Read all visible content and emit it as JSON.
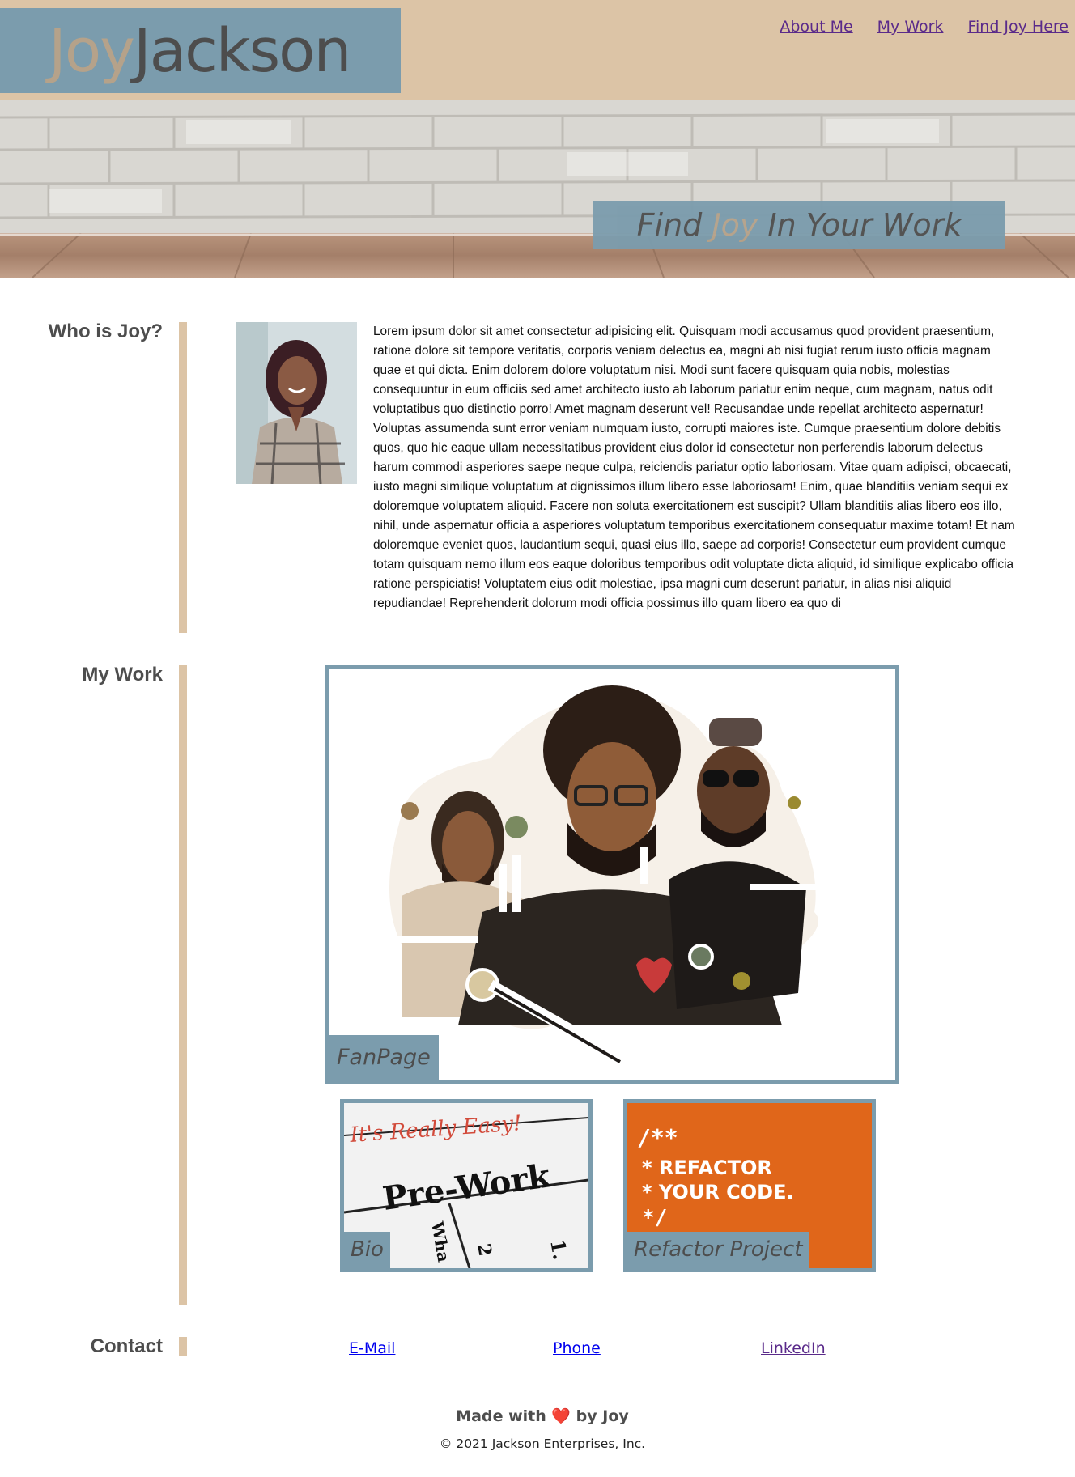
{
  "header": {
    "logo_first": "Joy",
    "logo_last": "Jackson",
    "nav": [
      "About Me",
      "My Work",
      "Find Joy Here"
    ]
  },
  "hero": {
    "text_before": "Find ",
    "text_highlight": "Joy",
    "text_after": " In Your Work"
  },
  "about": {
    "title": "Who is Joy?",
    "body": "Lorem ipsum dolor sit amet consectetur adipisicing elit. Quisquam modi accusamus quod provident praesentium, ratione dolore sit tempore veritatis, corporis veniam delectus ea, magni ab nisi fugiat rerum iusto officia magnam quae et qui dicta. Enim dolorem dolore voluptatum nisi. Modi sunt facere quisquam quia nobis, molestias consequuntur in eum officiis sed amet architecto iusto ab laborum pariatur enim neque, cum magnam, natus odit voluptatibus quo distinctio porro! Amet magnam deserunt vel! Recusandae unde repellat architecto aspernatur! Voluptas assumenda sunt error veniam numquam iusto, corrupti maiores iste. Cumque praesentium dolore debitis quos, quo hic eaque ullam necessitatibus provident eius dolor id consectetur non perferendis laborum delectus harum commodi asperiores saepe neque culpa, reiciendis pariatur optio laboriosam. Vitae quam adipisci, obcaecati, iusto magni similique voluptatum at dignissimos illum libero esse laboriosam! Enim, quae blanditiis veniam sequi ex doloremque voluptatem aliquid. Facere non soluta exercitationem est suscipit? Ullam blanditiis alias libero eos illo, nihil, unde aspernatur officia a asperiores voluptatum temporibus exercitationem consequatur maxime totam! Et nam doloremque eveniet quos, laudantium sequi, quasi eius illo, saepe ad corporis! Consectetur eum provident cumque totam quisquam nemo illum eos eaque doloribus temporibus odit voluptate dicta aliquid, id similique explicabo officia ratione perspiciatis! Voluptatem eius odit molestiae, ipsa magni cum deserunt pariatur, in alias nisi aliquid repudiandae! Reprehenderit dolorum modi officia possimus illo quam libero ea quo di"
  },
  "work": {
    "title": "My Work",
    "projects": [
      {
        "label": "FanPage"
      },
      {
        "label": "Bio",
        "image_text_1": "It's Really Easy!",
        "image_text_2": "Pre-Work",
        "image_text_3": "1.",
        "image_text_4": "2",
        "image_text_5": "Wha"
      },
      {
        "label": "Refactor Project",
        "image_text_1": "/**",
        "image_text_2": "*  REFACTOR",
        "image_text_3": "*  YOUR CODE.",
        "image_text_4": "*/"
      }
    ]
  },
  "contact": {
    "title": "Contact",
    "links": [
      "E-Mail",
      "Phone",
      "LinkedIn"
    ],
    "colors": {
      "email": "#0000ee",
      "phone": "#0000ee",
      "linkedin": "#5a2a8a"
    }
  },
  "footer": {
    "made_before": "Made with ",
    "heart": "❤️",
    "made_after": " by Joy",
    "copyright": "© 2021 Jackson Enterprises, Inc."
  },
  "colors": {
    "tan": "#dcc4a6",
    "steel_blue": "#7b9cad",
    "text_dark": "#4d4d4d",
    "refactor_orange": "#e0661a"
  }
}
